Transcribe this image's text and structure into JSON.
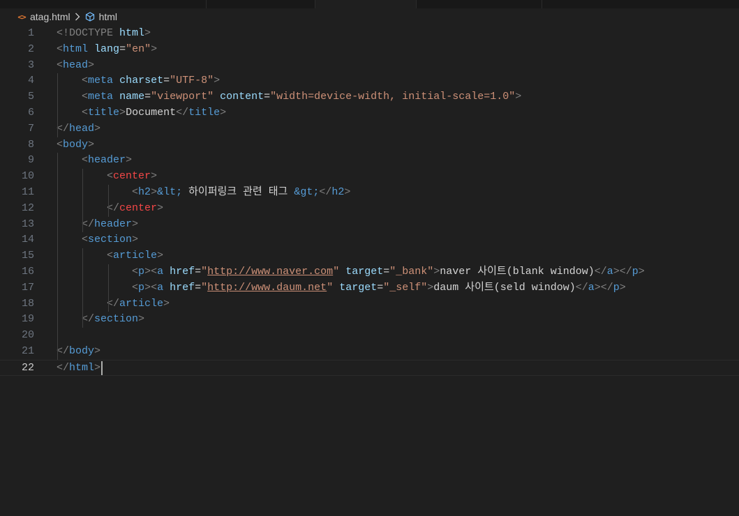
{
  "breadcrumb": {
    "file_icon": "html-file-icon",
    "file": "atag.html",
    "separator_icon": "chevron-right-icon",
    "symbol_icon": "cube-symbol-icon",
    "symbol": "html"
  },
  "editor": {
    "active_line": 22,
    "lines": [
      {
        "n": "1",
        "tokens": [
          {
            "t": "<!DOCTYPE ",
            "c": "punc"
          },
          {
            "t": "html",
            "c": "attr"
          },
          {
            "t": ">",
            "c": "punc"
          }
        ]
      },
      {
        "n": "2",
        "tokens": [
          {
            "t": "<",
            "c": "punc"
          },
          {
            "t": "html",
            "c": "tag"
          },
          {
            "t": " ",
            "c": "text"
          },
          {
            "t": "lang",
            "c": "attr"
          },
          {
            "t": "=",
            "c": "text"
          },
          {
            "t": "\"en\"",
            "c": "str"
          },
          {
            "t": ">",
            "c": "punc"
          }
        ]
      },
      {
        "n": "3",
        "tokens": [
          {
            "t": "<",
            "c": "punc"
          },
          {
            "t": "head",
            "c": "tag"
          },
          {
            "t": ">",
            "c": "punc"
          }
        ]
      },
      {
        "n": "4",
        "tokens": [
          {
            "t": "    ",
            "c": "text"
          },
          {
            "t": "<",
            "c": "punc"
          },
          {
            "t": "meta",
            "c": "tag"
          },
          {
            "t": " ",
            "c": "text"
          },
          {
            "t": "charset",
            "c": "attr"
          },
          {
            "t": "=",
            "c": "text"
          },
          {
            "t": "\"UTF-8\"",
            "c": "str"
          },
          {
            "t": ">",
            "c": "punc"
          }
        ]
      },
      {
        "n": "5",
        "tokens": [
          {
            "t": "    ",
            "c": "text"
          },
          {
            "t": "<",
            "c": "punc"
          },
          {
            "t": "meta",
            "c": "tag"
          },
          {
            "t": " ",
            "c": "text"
          },
          {
            "t": "name",
            "c": "attr"
          },
          {
            "t": "=",
            "c": "text"
          },
          {
            "t": "\"viewport\"",
            "c": "str"
          },
          {
            "t": " ",
            "c": "text"
          },
          {
            "t": "content",
            "c": "attr"
          },
          {
            "t": "=",
            "c": "text"
          },
          {
            "t": "\"width=device-width, initial-scale=1.0\"",
            "c": "str"
          },
          {
            "t": ">",
            "c": "punc"
          }
        ]
      },
      {
        "n": "6",
        "tokens": [
          {
            "t": "    ",
            "c": "text"
          },
          {
            "t": "<",
            "c": "punc"
          },
          {
            "t": "title",
            "c": "tag"
          },
          {
            "t": ">",
            "c": "punc"
          },
          {
            "t": "Document",
            "c": "text"
          },
          {
            "t": "</",
            "c": "punc"
          },
          {
            "t": "title",
            "c": "tag"
          },
          {
            "t": ">",
            "c": "punc"
          }
        ]
      },
      {
        "n": "7",
        "tokens": [
          {
            "t": "</",
            "c": "punc"
          },
          {
            "t": "head",
            "c": "tag"
          },
          {
            "t": ">",
            "c": "punc"
          }
        ]
      },
      {
        "n": "8",
        "tokens": [
          {
            "t": "<",
            "c": "punc"
          },
          {
            "t": "body",
            "c": "tag"
          },
          {
            "t": ">",
            "c": "punc"
          }
        ]
      },
      {
        "n": "9",
        "tokens": [
          {
            "t": "    ",
            "c": "text"
          },
          {
            "t": "<",
            "c": "punc"
          },
          {
            "t": "header",
            "c": "tag"
          },
          {
            "t": ">",
            "c": "punc"
          }
        ]
      },
      {
        "n": "10",
        "tokens": [
          {
            "t": "        ",
            "c": "text"
          },
          {
            "t": "<",
            "c": "punc"
          },
          {
            "t": "center",
            "c": "dep"
          },
          {
            "t": ">",
            "c": "punc"
          }
        ]
      },
      {
        "n": "11",
        "tokens": [
          {
            "t": "            ",
            "c": "text"
          },
          {
            "t": "<",
            "c": "punc"
          },
          {
            "t": "h2",
            "c": "tag"
          },
          {
            "t": ">",
            "c": "punc"
          },
          {
            "t": "&lt;",
            "c": "ent"
          },
          {
            "t": " 하이퍼링크 관련 태그 ",
            "c": "text"
          },
          {
            "t": "&gt;",
            "c": "ent"
          },
          {
            "t": "</",
            "c": "punc"
          },
          {
            "t": "h2",
            "c": "tag"
          },
          {
            "t": ">",
            "c": "punc"
          }
        ]
      },
      {
        "n": "12",
        "tokens": [
          {
            "t": "        ",
            "c": "text"
          },
          {
            "t": "</",
            "c": "punc"
          },
          {
            "t": "center",
            "c": "dep"
          },
          {
            "t": ">",
            "c": "punc"
          }
        ]
      },
      {
        "n": "13",
        "tokens": [
          {
            "t": "    ",
            "c": "text"
          },
          {
            "t": "</",
            "c": "punc"
          },
          {
            "t": "header",
            "c": "tag"
          },
          {
            "t": ">",
            "c": "punc"
          }
        ]
      },
      {
        "n": "14",
        "tokens": [
          {
            "t": "    ",
            "c": "text"
          },
          {
            "t": "<",
            "c": "punc"
          },
          {
            "t": "section",
            "c": "tag"
          },
          {
            "t": ">",
            "c": "punc"
          }
        ]
      },
      {
        "n": "15",
        "tokens": [
          {
            "t": "        ",
            "c": "text"
          },
          {
            "t": "<",
            "c": "punc"
          },
          {
            "t": "article",
            "c": "tag"
          },
          {
            "t": ">",
            "c": "punc"
          }
        ]
      },
      {
        "n": "16",
        "tokens": [
          {
            "t": "            ",
            "c": "text"
          },
          {
            "t": "<",
            "c": "punc"
          },
          {
            "t": "p",
            "c": "tag"
          },
          {
            "t": "><",
            "c": "punc"
          },
          {
            "t": "a",
            "c": "tag"
          },
          {
            "t": " ",
            "c": "text"
          },
          {
            "t": "href",
            "c": "attr"
          },
          {
            "t": "=",
            "c": "text"
          },
          {
            "t": "\"",
            "c": "str"
          },
          {
            "t": "http://www.naver.com",
            "c": "link"
          },
          {
            "t": "\"",
            "c": "str"
          },
          {
            "t": " ",
            "c": "text"
          },
          {
            "t": "target",
            "c": "attr"
          },
          {
            "t": "=",
            "c": "text"
          },
          {
            "t": "\"_bank\"",
            "c": "str"
          },
          {
            "t": ">",
            "c": "punc"
          },
          {
            "t": "naver 사이트(blank window)",
            "c": "text"
          },
          {
            "t": "</",
            "c": "punc"
          },
          {
            "t": "a",
            "c": "tag"
          },
          {
            "t": "></",
            "c": "punc"
          },
          {
            "t": "p",
            "c": "tag"
          },
          {
            "t": ">",
            "c": "punc"
          }
        ]
      },
      {
        "n": "17",
        "tokens": [
          {
            "t": "            ",
            "c": "text"
          },
          {
            "t": "<",
            "c": "punc"
          },
          {
            "t": "p",
            "c": "tag"
          },
          {
            "t": "><",
            "c": "punc"
          },
          {
            "t": "a",
            "c": "tag"
          },
          {
            "t": " ",
            "c": "text"
          },
          {
            "t": "href",
            "c": "attr"
          },
          {
            "t": "=",
            "c": "text"
          },
          {
            "t": "\"",
            "c": "str"
          },
          {
            "t": "http://www.daum.net",
            "c": "link"
          },
          {
            "t": "\"",
            "c": "str"
          },
          {
            "t": " ",
            "c": "text"
          },
          {
            "t": "target",
            "c": "attr"
          },
          {
            "t": "=",
            "c": "text"
          },
          {
            "t": "\"_self\"",
            "c": "str"
          },
          {
            "t": ">",
            "c": "punc"
          },
          {
            "t": "daum 사이트(seld window)",
            "c": "text"
          },
          {
            "t": "</",
            "c": "punc"
          },
          {
            "t": "a",
            "c": "tag"
          },
          {
            "t": "></",
            "c": "punc"
          },
          {
            "t": "p",
            "c": "tag"
          },
          {
            "t": ">",
            "c": "punc"
          }
        ]
      },
      {
        "n": "18",
        "tokens": [
          {
            "t": "        ",
            "c": "text"
          },
          {
            "t": "</",
            "c": "punc"
          },
          {
            "t": "article",
            "c": "tag"
          },
          {
            "t": ">",
            "c": "punc"
          }
        ]
      },
      {
        "n": "19",
        "tokens": [
          {
            "t": "    ",
            "c": "text"
          },
          {
            "t": "</",
            "c": "punc"
          },
          {
            "t": "section",
            "c": "tag"
          },
          {
            "t": ">",
            "c": "punc"
          }
        ]
      },
      {
        "n": "20",
        "tokens": []
      },
      {
        "n": "21",
        "tokens": [
          {
            "t": "</",
            "c": "punc"
          },
          {
            "t": "body",
            "c": "tag"
          },
          {
            "t": ">",
            "c": "punc"
          }
        ]
      },
      {
        "n": "22",
        "tokens": [
          {
            "t": "</",
            "c": "punc"
          },
          {
            "t": "html",
            "c": "tag"
          },
          {
            "t": ">",
            "c": "punc"
          }
        ]
      }
    ]
  },
  "colors": {
    "background": "#1f1f1f",
    "tag": "#569cd6",
    "attribute": "#9cdcfe",
    "string": "#ce9178",
    "deprecated_tag": "#f44747",
    "punctuation": "#808080",
    "line_number": "#6e7681"
  }
}
